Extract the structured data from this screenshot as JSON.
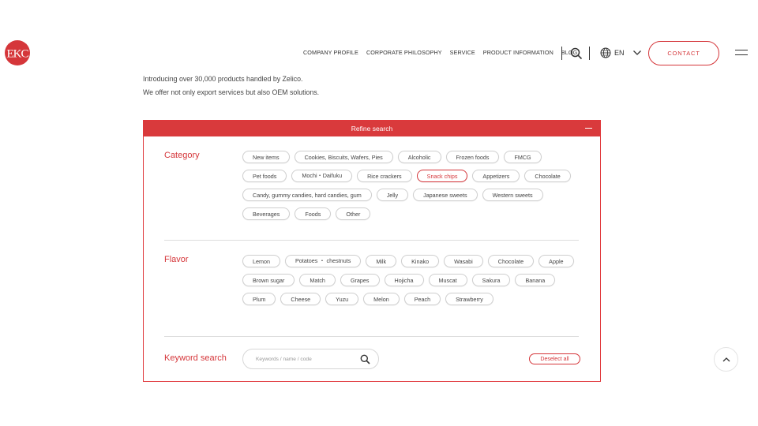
{
  "header": {
    "logo_text": "EKC",
    "nav": [
      "COMPANY PROFILE",
      "CORPORATE PHILOSOPHY",
      "SERVICE",
      "PRODUCT INFORMATION",
      "BLOG"
    ],
    "language": "EN",
    "contact_label": "CONTACT"
  },
  "intro": {
    "line1": "Introducing over 30,000 products handled by Zelico.",
    "line2": "We offer not only export services but also OEM solutions."
  },
  "panel": {
    "title": "Refine search",
    "category": {
      "label": "Category",
      "tags": [
        "New items",
        "Cookies, Biscuits, Wafers, Pies",
        "Alcoholic",
        "Frozen foods",
        "FMCG",
        "Pet foods",
        "Mochi・Daifuku",
        "Rice crackers",
        "Snack chips",
        "Appetizers",
        "Chocolate",
        "Candy, gummy candies, hard candies, gum",
        "Jelly",
        "Japanese sweets",
        "Western sweets",
        "Beverages",
        "Foods",
        "Other"
      ],
      "active": "Snack chips"
    },
    "flavor": {
      "label": "Flavor",
      "tags": [
        "Lemon",
        "Potatoes ・ chestnuts",
        "Milk",
        "Kinako",
        "Wasabi",
        "Chocolate",
        "Apple",
        "Brown sugar",
        "Match",
        "Grapes",
        "Hojicha",
        "Muscat",
        "Sakura",
        "Banana",
        "Plum",
        "Cheese",
        "Yuzu",
        "Melon",
        "Peach",
        "Strawberry"
      ]
    },
    "keyword": {
      "label": "Keyword search",
      "placeholder": "Keywords / name / code"
    },
    "deselect_label": "Deselect all"
  },
  "colors": {
    "accent": "#d93a3c"
  }
}
